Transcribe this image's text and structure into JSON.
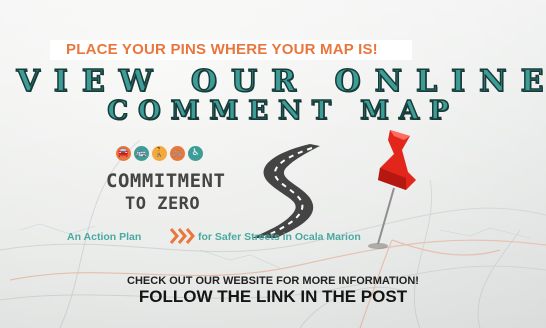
{
  "banner": {
    "text": "PLACE YOUR PINS WHERE YOUR MAP IS!"
  },
  "headline": {
    "line1": "VIEW OUR ONLINE",
    "line2": "COMMENT MAP"
  },
  "logo": {
    "line1": "COMMITMENT",
    "line2": "TO ZERO",
    "tagline_left": "An Action Plan",
    "tagline_right": "for Safer Streets in Ocala Marion",
    "icons": [
      {
        "name": "car-icon",
        "glyph": "🚘",
        "color": "#e9773d"
      },
      {
        "name": "bus-icon",
        "glyph": "🚌",
        "color": "#3e9c96"
      },
      {
        "name": "pedestrian-icon",
        "glyph": "🚶",
        "color": "#f3a93b"
      },
      {
        "name": "bicycle-icon",
        "glyph": "🚲",
        "color": "#e9773d"
      },
      {
        "name": "wheelchair-icon",
        "glyph": "♿",
        "color": "#3e9c96"
      }
    ]
  },
  "footer": {
    "line1": "CHECK OUT OUR WEBSITE FOR MORE INFORMATION!",
    "line2": "FOLLOW THE LINK IN THE POST"
  },
  "colors": {
    "accent_orange": "#e9773d",
    "accent_teal": "#3e9c96",
    "pin_red": "#e2261c"
  }
}
